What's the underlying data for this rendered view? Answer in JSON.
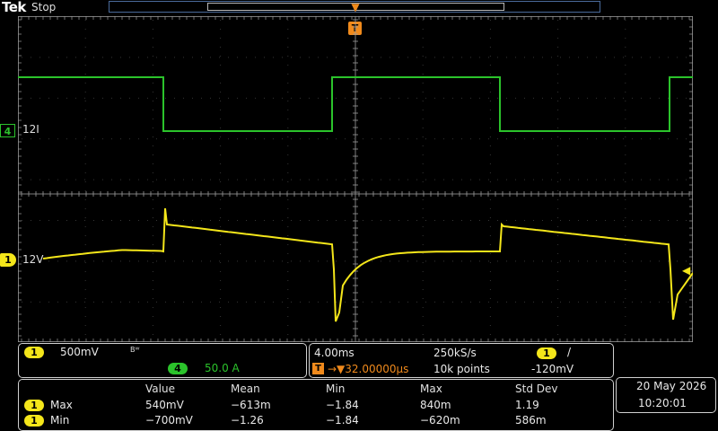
{
  "header": {
    "brand": "Tek",
    "acq_status": "Stop",
    "trigger_marker": "T"
  },
  "channels": {
    "ch4": {
      "number": "4",
      "label": "12I",
      "color": "#2bc32b"
    },
    "ch1": {
      "number": "1",
      "label": "12V",
      "color": "#f4e61a"
    }
  },
  "vertical": {
    "ch1_number": "1",
    "ch1_scale": "500mV",
    "bw_indicator": "Bᵂ",
    "ch4_number": "4",
    "ch4_scale": "50.0 A"
  },
  "horizontal": {
    "time_scale": "4.00ms",
    "sample_rate": "250kS/s",
    "trigger_source": "1",
    "trigger_slope": "/",
    "trigger_icon": "T",
    "trigger_delay": "→▼32.00000µs",
    "record_length": "10k points",
    "trigger_level": "-120mV"
  },
  "measurements": {
    "headers": [
      "Value",
      "Mean",
      "Min",
      "Max",
      "Std Dev"
    ],
    "rows": [
      {
        "channel": "1",
        "name": "Max",
        "values": [
          "540mV",
          "−613m",
          "−1.84",
          "840m",
          "1.19"
        ]
      },
      {
        "channel": "1",
        "name": "Min",
        "values": [
          "−700mV",
          "−1.26",
          "−1.84",
          "−620m",
          "586m"
        ]
      }
    ]
  },
  "datetime": {
    "date": "20 May  2026",
    "time": "10:20:01"
  },
  "colors": {
    "grid": "#9a9a9a",
    "ch1": "#f4e61a",
    "ch4": "#2bc32b",
    "trigger": "#f08a1c"
  }
}
